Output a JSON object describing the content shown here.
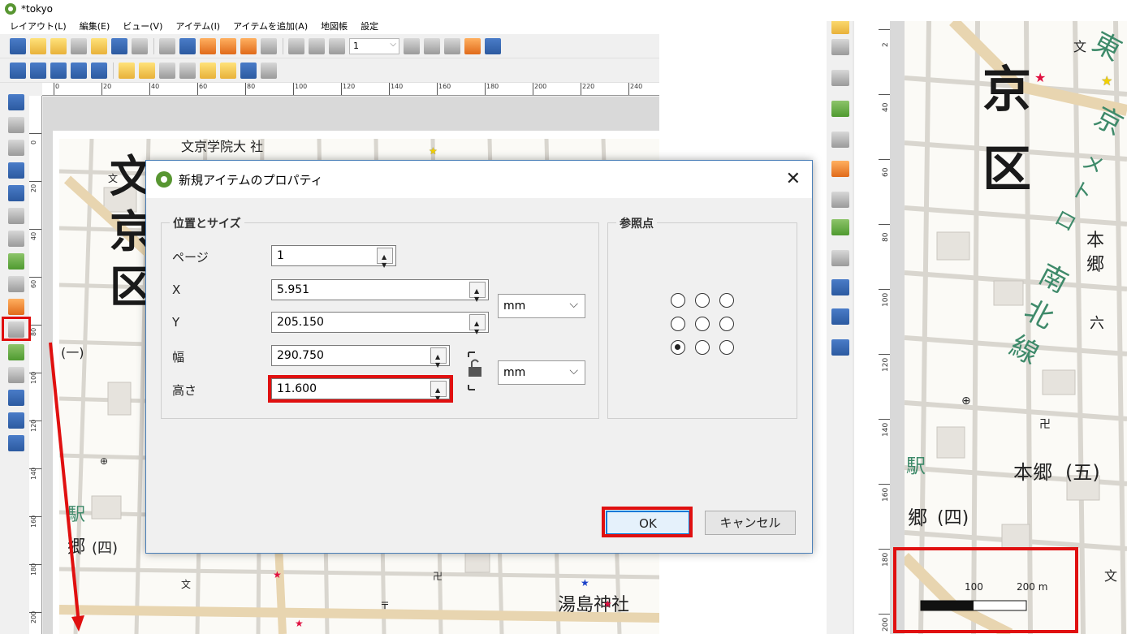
{
  "window": {
    "title": "*tokyo"
  },
  "menu": [
    "レイアウト(L)",
    "編集(E)",
    "ビュー(V)",
    "アイテム(I)",
    "アイテムを追加(A)",
    "地図帳",
    "設定"
  ],
  "toolbar": {
    "page_value": "1"
  },
  "ruler_h": [
    "0",
    "20",
    "40",
    "60",
    "80",
    "100",
    "120",
    "140",
    "160",
    "180",
    "200",
    "220",
    "240"
  ],
  "ruler_v": [
    "0",
    "20",
    "40",
    "60",
    "80",
    "100",
    "120",
    "140",
    "160",
    "180",
    "200"
  ],
  "map_left": {
    "kanji": [
      "文",
      "京",
      "区"
    ],
    "labels": [
      "駅",
      "郷",
      "(四)",
      "湯島神社",
      "(一)"
    ],
    "header_text": "文京学院大 社"
  },
  "dialog": {
    "title": "新規アイテムのプロパティ",
    "group_position": "位置とサイズ",
    "group_reference": "参照点",
    "fields": [
      {
        "label": "ページ",
        "value": "1"
      },
      {
        "label": "X",
        "value": "5.951"
      },
      {
        "label": "Y",
        "value": "205.150"
      },
      {
        "label": "幅",
        "value": "290.750"
      },
      {
        "label": "高さ",
        "value": "11.600"
      }
    ],
    "unit_position": "mm",
    "unit_size": "mm",
    "reference_selected": "bottom-left",
    "ok": "OK",
    "cancel": "キャンセル"
  },
  "right_panel": {
    "ruler": [
      "2",
      "40",
      "60",
      "80",
      "100",
      "120",
      "140",
      "160",
      "180",
      "200"
    ],
    "kanji": [
      "京",
      "区"
    ],
    "green_text": [
      "東",
      "京",
      "メ",
      "ト",
      "ロ",
      "南",
      "北",
      "線"
    ],
    "labels": [
      "本",
      "郷",
      "本郷",
      "(五)",
      "駅",
      "郷",
      "(四)",
      "六"
    ],
    "scalebar": {
      "label_100": "100",
      "label_200": "200 m"
    }
  },
  "colors": {
    "highlight": "#e01010",
    "qgis_green": "#589632",
    "dialog_border": "#4a7fb8",
    "metro_green": "#3e8a6a"
  }
}
